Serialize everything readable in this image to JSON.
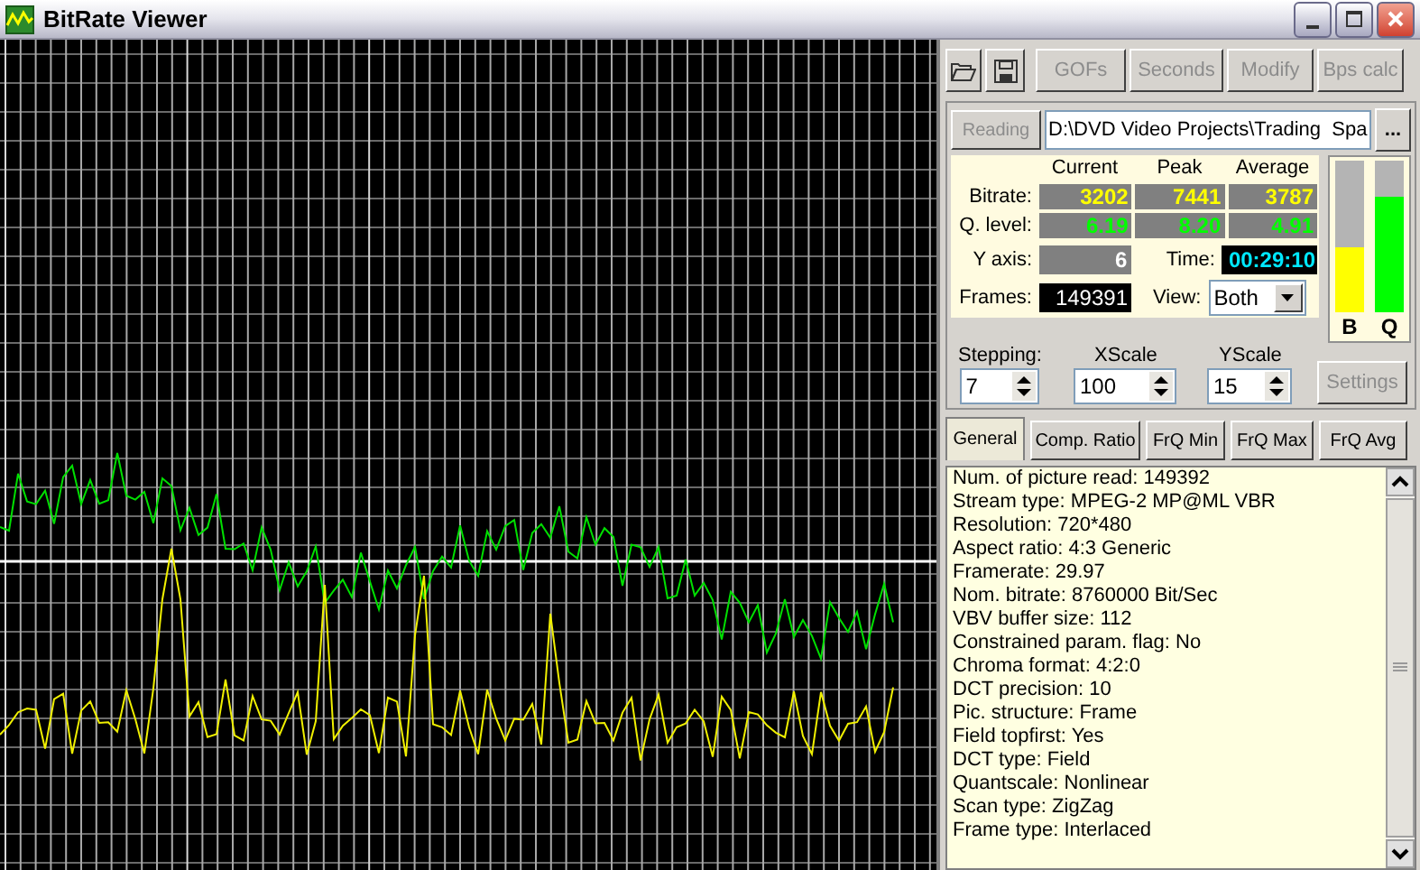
{
  "window": {
    "title": "BitRate Viewer"
  },
  "toolbar": {
    "buttons": [
      {
        "label": "GOFs",
        "disabled": true
      },
      {
        "label": "Seconds",
        "disabled": true
      },
      {
        "label": "Modify",
        "disabled": true
      },
      {
        "label": "Bps calc",
        "disabled": true
      }
    ]
  },
  "source": {
    "button": {
      "label": "Reading",
      "disabled": true
    },
    "path": "D:\\DVD Video Projects\\Trading  Spa",
    "browse": "..."
  },
  "stats": {
    "headers": [
      "Current",
      "Peak",
      "Average"
    ],
    "rows": [
      {
        "label": "Bitrate:",
        "values": [
          "3202",
          "7441",
          "3787"
        ],
        "kind": "bitrate"
      },
      {
        "label": "Q. level:",
        "values": [
          "6.19",
          "8.20",
          "4.91"
        ],
        "kind": "quality"
      }
    ],
    "y_axis": {
      "label": "Y axis:",
      "value": "6"
    },
    "time": {
      "label": "Time:",
      "value": "00:29:10"
    },
    "frames": {
      "label": "Frames:",
      "value": "149391"
    },
    "view": {
      "label": "View:",
      "value": "Both"
    }
  },
  "meters": [
    {
      "label": "B",
      "level": 0.43,
      "color": "#ffff00"
    },
    {
      "label": "Q",
      "level": 0.76,
      "color": "#00ff00"
    }
  ],
  "spinners": [
    {
      "label": "Stepping:",
      "value": "7"
    },
    {
      "label": "XScale",
      "value": "100"
    },
    {
      "label": "YScale",
      "value": "15"
    }
  ],
  "settings_button": {
    "label": "Settings",
    "disabled": true
  },
  "tabs": [
    {
      "label": "General",
      "selected": true
    },
    {
      "label": "Comp. Ratio",
      "selected": false
    },
    {
      "label": "FrQ Min",
      "selected": false
    },
    {
      "label": "FrQ Max",
      "selected": false
    },
    {
      "label": "FrQ Avg",
      "selected": false
    }
  ],
  "info_lines": [
    "Num. of picture read: 149392",
    "Stream type: MPEG-2  MP@ML  VBR",
    "Resolution: 720*480",
    "Aspect ratio: 4:3 Generic",
    "Framerate: 29.97",
    "Nom. bitrate: 8760000 Bit/Sec",
    "VBV buffer size: 112",
    "Constrained param. flag: No",
    "Chroma format: 4:2:0",
    "DCT precision: 10",
    "Pic. structure: Frame",
    "Field topfirst: Yes",
    "DCT type: Field",
    "Quantscale: Nonlinear",
    "Scan type: ZigZag",
    "Frame type: Interlaced"
  ]
}
